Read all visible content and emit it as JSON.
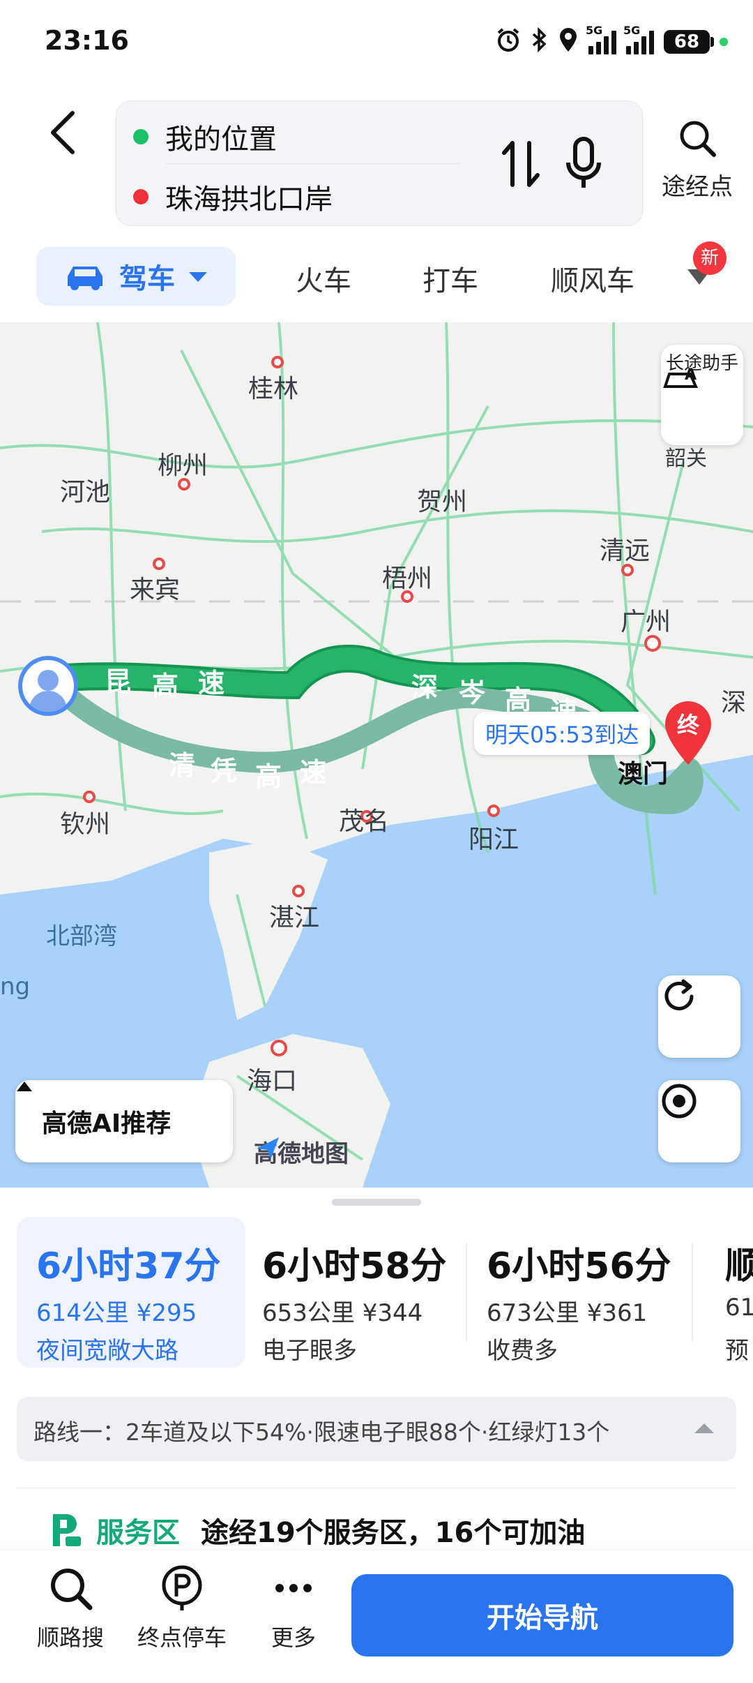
{
  "status_bar": {
    "time": "23:16",
    "battery": "68",
    "network_1": "5G",
    "network_2": "5G",
    "icons": [
      "alarm-icon",
      "bluetooth-icon",
      "location-icon",
      "signal-icon",
      "signal-icon",
      "battery-icon"
    ]
  },
  "header": {
    "origin": "我的位置",
    "destination": "珠海拱北口岸",
    "waypoint_label": "途经点"
  },
  "mode_tabs": {
    "drive": "驾车",
    "train": "火车",
    "taxi": "打车",
    "carpool": "顺风车",
    "badge": "新"
  },
  "map": {
    "cities": {
      "guilin": "桂林",
      "liuzhou": "柳州",
      "hechi": "河池",
      "hezhou": "贺州",
      "laibin": "来宾",
      "wuzhou": "梧州",
      "qingyuan": "清远",
      "guangzhou": "广州",
      "shen": "深",
      "qinzhou": "钦州",
      "maoming": "茂名",
      "yangjiang": "阳江",
      "zhanjiang": "湛江",
      "haikou": "海口",
      "macau": "澳门",
      "shaoguan_partial": "韶关"
    },
    "sea": "北部湾",
    "edge_text": "ng",
    "roads": {
      "main_1": [
        "昆",
        "高",
        "速"
      ],
      "main_2": [
        "深",
        "岑",
        "高",
        "速"
      ],
      "alt": [
        "清",
        "凭",
        "高",
        "速"
      ]
    },
    "eta": "明天05:53到达",
    "end_marker": "终",
    "assist_label": "长途助手",
    "ai_pill": "高德AI推荐",
    "brand": "高德地图"
  },
  "routes": [
    {
      "time": "6小时37分",
      "distance": "614公里",
      "toll": "¥295",
      "note": "夜间宽敞大路"
    },
    {
      "time": "6小时58分",
      "distance": "653公里",
      "toll": "¥344",
      "note": "电子眼多"
    },
    {
      "time": "6小时56分",
      "distance": "673公里",
      "toll": "¥361",
      "note": "收费多"
    },
    {
      "time": "顺",
      "distance": "61",
      "toll": "",
      "note": "预"
    }
  ],
  "route_detail": "路线一：2车道及以下54%·限速电子眼88个·红绿灯13个",
  "service": {
    "tag": "服务区",
    "text": "途经19个服务区，16个可加油"
  },
  "bottom_nav": {
    "search_along": "顺路搜",
    "end_parking": "终点停车",
    "more": "更多",
    "start": "开始导航"
  }
}
